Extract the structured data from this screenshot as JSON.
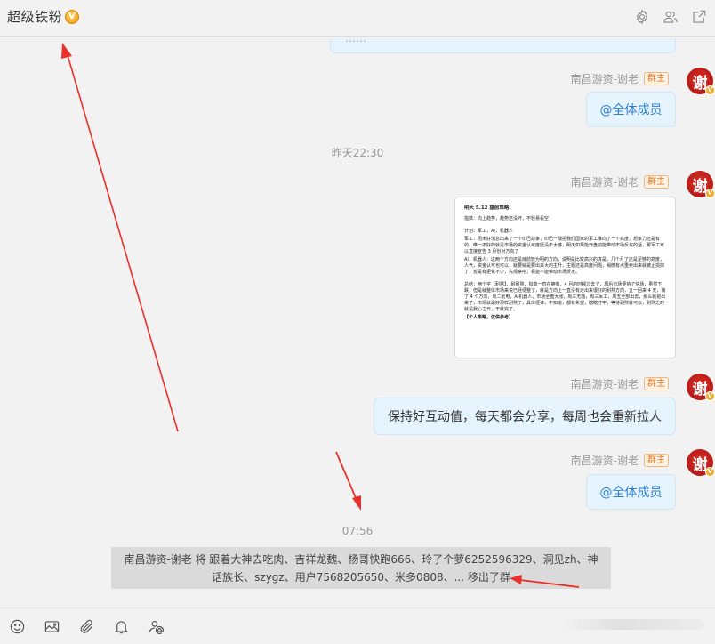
{
  "header": {
    "title": "超级铁粉",
    "badge_text": "V"
  },
  "messages": [
    {
      "sender": "南昌游资-谢老",
      "role_tag": "群主",
      "text": "@全体成员"
    },
    {
      "sender": "南昌游资-谢老",
      "role_tag": "群主"
    },
    {
      "sender": "南昌游资-谢老",
      "role_tag": "群主",
      "text": "保持好互动值，每天都会分享，每周也会重新拉人"
    },
    {
      "sender": "南昌游资-谢老",
      "role_tag": "群主",
      "text": "@全体成员"
    }
  ],
  "timestamps": [
    "昨天22:30",
    "07:56"
  ],
  "avatar_char": "谢",
  "avatar_badge": "V",
  "image_message": {
    "heading": "明天 5.12 盘前策略：",
    "lines": [
      "指数：向上趋势，趋势还没坏，不轻易看空",
      "计划：军工，AI，机器人",
      "军工：周末好消息出来了一个印巴战争，印巴一战把我们国家的军工推向了一个高度，想象力还是有的。唯一不好的就是市场的资金认可度愿没不太够，明天如果能开盘前能带动市场反攻的话，那军工可以直接宣告 3 月份对方向了",
      "AI，机器人：这两个方向还是目前较为明的方向，说明是比较高兴的真是，几个月了还是足够的高度，人气，资金认可也可以，就要就是要出来大的主升，主题还是高度问题，稍微有点重卖出来就被止损掉了，暂是有更化不少，先观察吧，看能不能带动市场反攻。",
      "总结：两个字【耐熬】，耐耐熬，指数一直在拥有，4 月的时候过去了，周后市场便拾了信场，虽然下跌，但是就整体市场来说已经便整了，就是方向上一直没有走出来很好的耐熬方向，五一回来 4 天，接了 4 个方向，周二纸电，AI机器人，市场全盘大涨，周三无题，周三军工，周五全部出去，那么就把出来了，市场就最好那样耐熬了，具体便谁，不知道，都有希望，瞎瞎打牢，等待耐熬就可以，耐熬之时就是我心之日，干就完了。",
      "【个人策略，仅供参考】"
    ]
  },
  "system_notice": "南昌游资-谢老 将 跟着大神去吃肉、吉祥龙魏、杨哥快跑666、玲了个萝6252596329、洞见zh、神话族长、szygz、用户7568205650、米多0808、... 移出了群",
  "colors": {
    "bubble": "#e4f3fc",
    "mention": "#2d7fd3",
    "owner_tag": "#e7761e",
    "arrow": "#e8312a",
    "avatar": "#c0201a"
  },
  "icons": {
    "header": [
      "gear-icon",
      "group-members-icon",
      "open-external-icon"
    ],
    "toolbar": [
      "emoji-icon",
      "image-icon",
      "attachment-icon",
      "bell-icon",
      "mention-user-icon"
    ]
  }
}
